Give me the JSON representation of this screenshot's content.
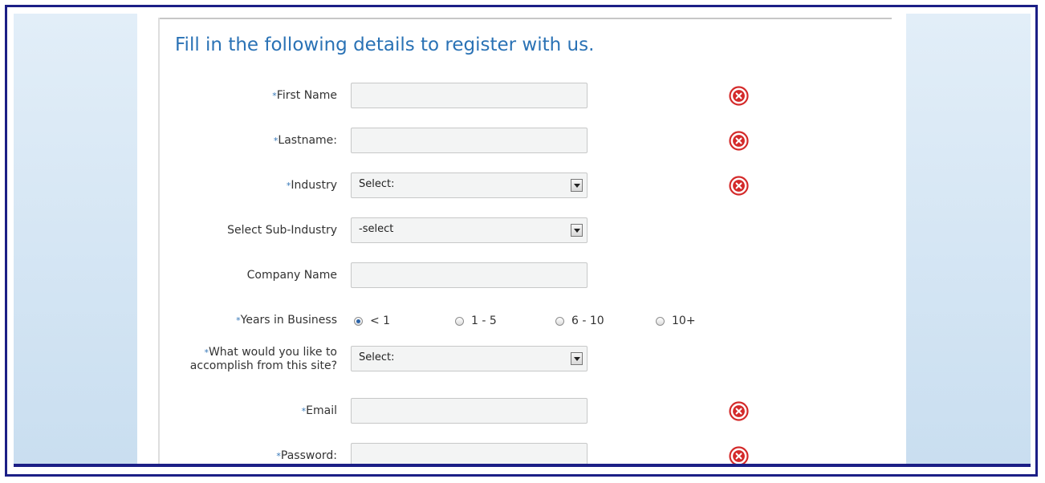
{
  "form": {
    "title": "Fill in the following details to register with us.",
    "required_mark": "*",
    "first_name": {
      "label": "First Name",
      "value": ""
    },
    "last_name": {
      "label": "Lastname:",
      "value": ""
    },
    "industry": {
      "label": "Industry",
      "selected": "Select:"
    },
    "sub_industry": {
      "label": "Select Sub-Industry",
      "selected": "-select"
    },
    "company_name": {
      "label": "Company Name",
      "value": ""
    },
    "years_in_business": {
      "label": "Years in Business",
      "options": [
        "< 1",
        "1 - 5",
        "6 - 10",
        "10+"
      ],
      "selected": "< 1"
    },
    "goal": {
      "label_line1": "What would you like to",
      "label_line2": "accomplish from this site?",
      "selected": "Select:"
    },
    "email": {
      "label": "Email",
      "value": ""
    },
    "password": {
      "label": "Password:",
      "value": ""
    }
  },
  "colors": {
    "title": "#2a72b5",
    "error_icon": "#d42a2a",
    "frame_border": "#1c1f86"
  },
  "icons": {
    "error": "error-x-icon",
    "dropdown": "chevron-down-icon"
  }
}
